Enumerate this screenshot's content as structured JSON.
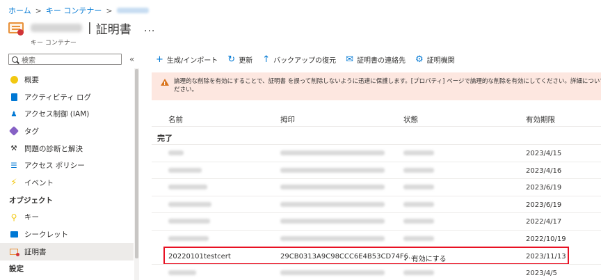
{
  "breadcrumb": {
    "home": "ホーム",
    "sep": ">",
    "parent": "キー コンテナー"
  },
  "header": {
    "title": "証明書",
    "subtitle": "キー コンテナー",
    "more": "..."
  },
  "sidebar": {
    "search_placeholder": "検索",
    "collapse": "«",
    "items": [
      {
        "label": "概要",
        "icon": "overview-icon"
      },
      {
        "label": "アクティビティ ログ",
        "icon": "activity-log-icon"
      },
      {
        "label": "アクセス制御 (IAM)",
        "icon": "people-icon"
      },
      {
        "label": "タグ",
        "icon": "tag-icon"
      },
      {
        "label": "問題の診断と解決",
        "icon": "wrench-icon"
      },
      {
        "label": "アクセス ポリシー",
        "icon": "list-icon"
      },
      {
        "label": "イベント",
        "icon": "bolt-icon"
      }
    ],
    "section_objects": "オブジェクト",
    "objects": [
      {
        "label": "キー",
        "icon": "key-icon"
      },
      {
        "label": "シークレット",
        "icon": "secret-icon"
      },
      {
        "label": "証明書",
        "icon": "certificate-icon"
      }
    ],
    "section_settings": "設定"
  },
  "toolbar": {
    "generate": "生成/インポート",
    "refresh": "更新",
    "backup": "バックアップの復元",
    "contacts": "証明書の連絡先",
    "ca": "証明機関"
  },
  "banner": {
    "line1": "論理的な削除を有効にすることで、証明書 を誤って削除しないように迅速に保護します。[プロパティ] ページで論理的な削除を有効にしてください。詳細については、こちらを",
    "line2": "ださい。"
  },
  "table": {
    "headers": {
      "name": "名前",
      "thumbprint": "拇印",
      "status": "状態",
      "expires": "有効期限"
    },
    "group": "完了",
    "rows": [
      {
        "expires": "2023/4/15"
      },
      {
        "expires": "2023/4/16"
      },
      {
        "expires": "2023/6/19"
      },
      {
        "expires": "2023/6/19"
      },
      {
        "expires": "2022/4/17"
      },
      {
        "expires": "2022/10/19"
      },
      {
        "name": "20220101testcert",
        "thumbprint": "29CB0313A9C98CCC6E4B53CD74F6...",
        "status": "有効にする",
        "expires": "2023/11/13"
      },
      {
        "expires": "2023/4/5"
      }
    ]
  }
}
